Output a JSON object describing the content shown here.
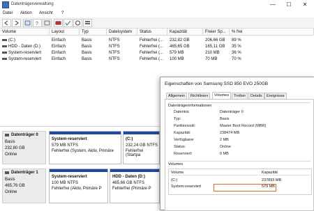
{
  "window": {
    "title": "Datenträgerverwaltung",
    "minimize": "—",
    "maximize": "☐",
    "close": "✕"
  },
  "menu": [
    "Datei",
    "Aktion",
    "Ansicht",
    "?"
  ],
  "columns": [
    "Volume",
    "Layout",
    "Typ",
    "Dateisystem",
    "Status",
    "Kapazität",
    "Freier Sp...",
    "% frei"
  ],
  "volumes": [
    [
      "(C:)",
      "Einfach",
      "Basis",
      "NTFS",
      "Fehlerfrei (...",
      "232,82 GB",
      "206,66 GB",
      "89 %"
    ],
    [
      "HDD - Daten (D:)",
      "Einfach",
      "Basis",
      "NTFS",
      "Fehlerfrei (...",
      "465,65 GB",
      "165,11 GB",
      "35 %"
    ],
    [
      "System-reserviert",
      "Einfach",
      "Basis",
      "NTFS",
      "Fehlerfrei (...",
      "579 MB",
      "210 MB",
      "36 %"
    ],
    [
      "System-reserviert",
      "Einfach",
      "Basis",
      "NTFS",
      "Fehlerfrei (...",
      "100 MB",
      "70 MB",
      "70 %"
    ]
  ],
  "disks": [
    {
      "name": "Datenträger 0",
      "type": "Basis",
      "size": "232,80 GB",
      "status": "Online",
      "parts": [
        {
          "title": "System-reserviert",
          "size": "579 MB NTFS",
          "status": "Fehlerfrei (System, Aktiv, Primäre"
        },
        {
          "title": "(C:)",
          "size": "232,24 GB NTFS",
          "status": "Fehlerfrei (Startpa"
        }
      ]
    },
    {
      "name": "Datenträger 1",
      "type": "Basis",
      "size": "465,76 GB",
      "status": "Online",
      "parts": [
        {
          "title": "System-reserviert",
          "size": "100 MB NTFS",
          "status": "Fehlerfrei (Aktiv, Primäre P"
        },
        {
          "title": "HDD - Daten (D:)",
          "size": "465,66 GB NTFS",
          "status": "Fehlerfrei (Primäre P"
        }
      ]
    }
  ],
  "dialog": {
    "title": "Eigenschaften von Samsung SSD 850 EVO 250GB",
    "tabs": [
      "Allgemein",
      "Richtlinien",
      "Volumes",
      "Treiber",
      "Details",
      "Ereignisse"
    ],
    "section": "Datenträgerinformationen",
    "fields": [
      {
        "label": "Datenträ:",
        "value": "Datenträger 0"
      },
      {
        "label": "Typ:",
        "value": "Basis"
      },
      {
        "label": "Partitionsstil:",
        "value": "Master Boot Record (MBR)"
      },
      {
        "label": "Kapazität:",
        "value": "238474 MB"
      },
      {
        "label": "Verfügbarer",
        "value": "2 MB"
      },
      {
        "label": "Status:",
        "value": "Online"
      },
      {
        "label": "Reserviert:",
        "value": "0 MB"
      }
    ],
    "volumes_section": "Volumes",
    "vol_header": {
      "name": "Volume",
      "cap": "Kapazität"
    },
    "vol_rows": [
      {
        "name": "(C:)",
        "cap": "237893 MB"
      },
      {
        "name": "System-reserviert",
        "cap": "579 MB"
      }
    ]
  }
}
